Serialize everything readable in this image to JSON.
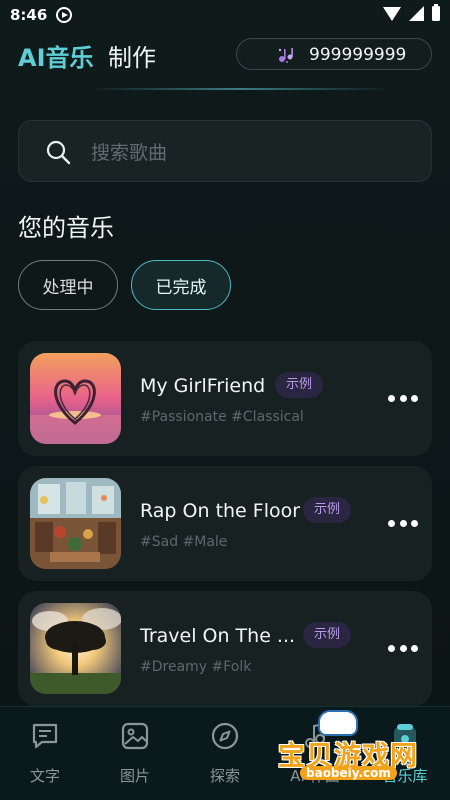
{
  "status_bar": {
    "time": "8:46"
  },
  "header": {
    "brand": "AI音乐",
    "brand_suffix": "制作",
    "credits": "999999999"
  },
  "search": {
    "placeholder": "搜索歌曲",
    "value": ""
  },
  "section": {
    "title": "您的音乐"
  },
  "filters": [
    {
      "label": "处理中",
      "active": false
    },
    {
      "label": "已完成",
      "active": true
    }
  ],
  "songs": [
    {
      "title": "My GirlFriend",
      "badge": "示例",
      "tags": "#Passionate #Classical",
      "cover": "heart-sunset-cover"
    },
    {
      "title": "Rap On the Floor",
      "badge": "示例",
      "tags": "#Sad #Male",
      "cover": "cafe-room-cover"
    },
    {
      "title": "Travel On The ...",
      "badge": "示例",
      "tags": "#Dreamy #Folk",
      "cover": "tree-sky-cover"
    }
  ],
  "nav": [
    {
      "label": "文字",
      "icon": "text-message-icon",
      "active": false
    },
    {
      "label": "图片",
      "icon": "image-icon",
      "active": false
    },
    {
      "label": "探索",
      "icon": "compass-icon",
      "active": false
    },
    {
      "label": "AI 作曲",
      "icon": "music-note-icon",
      "active": false
    },
    {
      "label": "音乐库",
      "icon": "music-library-icon",
      "active": true
    }
  ],
  "watermark": {
    "text": "宝贝游戏网",
    "domain": "baobeiy.com"
  },
  "colors": {
    "accent": "#5fcfd6",
    "background": "#0e1718",
    "badge": "#b79ae8"
  }
}
